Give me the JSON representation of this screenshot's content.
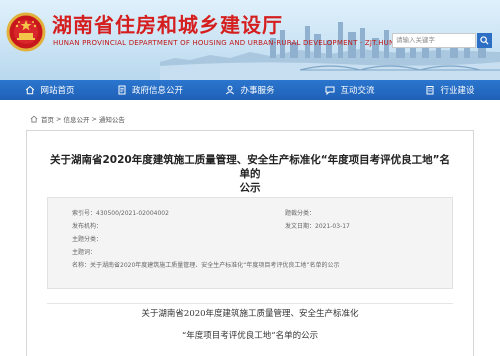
{
  "header": {
    "title": "湖南省住房和城乡建设厅",
    "subtitle": "HUNAN PROVINCIAL DEPARTMENT OF HOUSING AND URBAN-RURAL DEVELOPMENT · ZJT.HUNAN.GOV.CN",
    "search_placeholder": "请输入关键字"
  },
  "nav": [
    {
      "label": "网站首页",
      "icon": "home-icon"
    },
    {
      "label": "政府信息公开",
      "icon": "document-icon"
    },
    {
      "label": "办事服务",
      "icon": "service-icon"
    },
    {
      "label": "互动交流",
      "icon": "chat-icon"
    },
    {
      "label": "行业建设",
      "icon": "building-icon"
    }
  ],
  "breadcrumb": [
    "首页",
    "信息公开",
    "通知公告"
  ],
  "article": {
    "title_line1": "关于湖南省2020年度建筑施工质量管理、安全生产标准化“年度项目考评优良工地”名单的",
    "title_line2": "公示",
    "meta": {
      "index_no": "索引号：430500/2021-02004002",
      "category": "题裁分类：",
      "publisher": "发布机构：",
      "date": "发文日期：2021-03-17",
      "subject": "主题分类：",
      "subject_words": "主题词：",
      "name": "名称：关于湖南省2020年度建筑施工质量管理、安全生产标准化“年度项目考评优良工地”名单的公示"
    },
    "body_title_line1": "关于湖南省2020年度建筑施工质量管理、安全生产标准化",
    "body_title_line2": "“年度项目考评优良工地”名单的公示"
  },
  "colors": {
    "brand_red": "#d51f1f",
    "nav_blue": "#2267bd"
  }
}
